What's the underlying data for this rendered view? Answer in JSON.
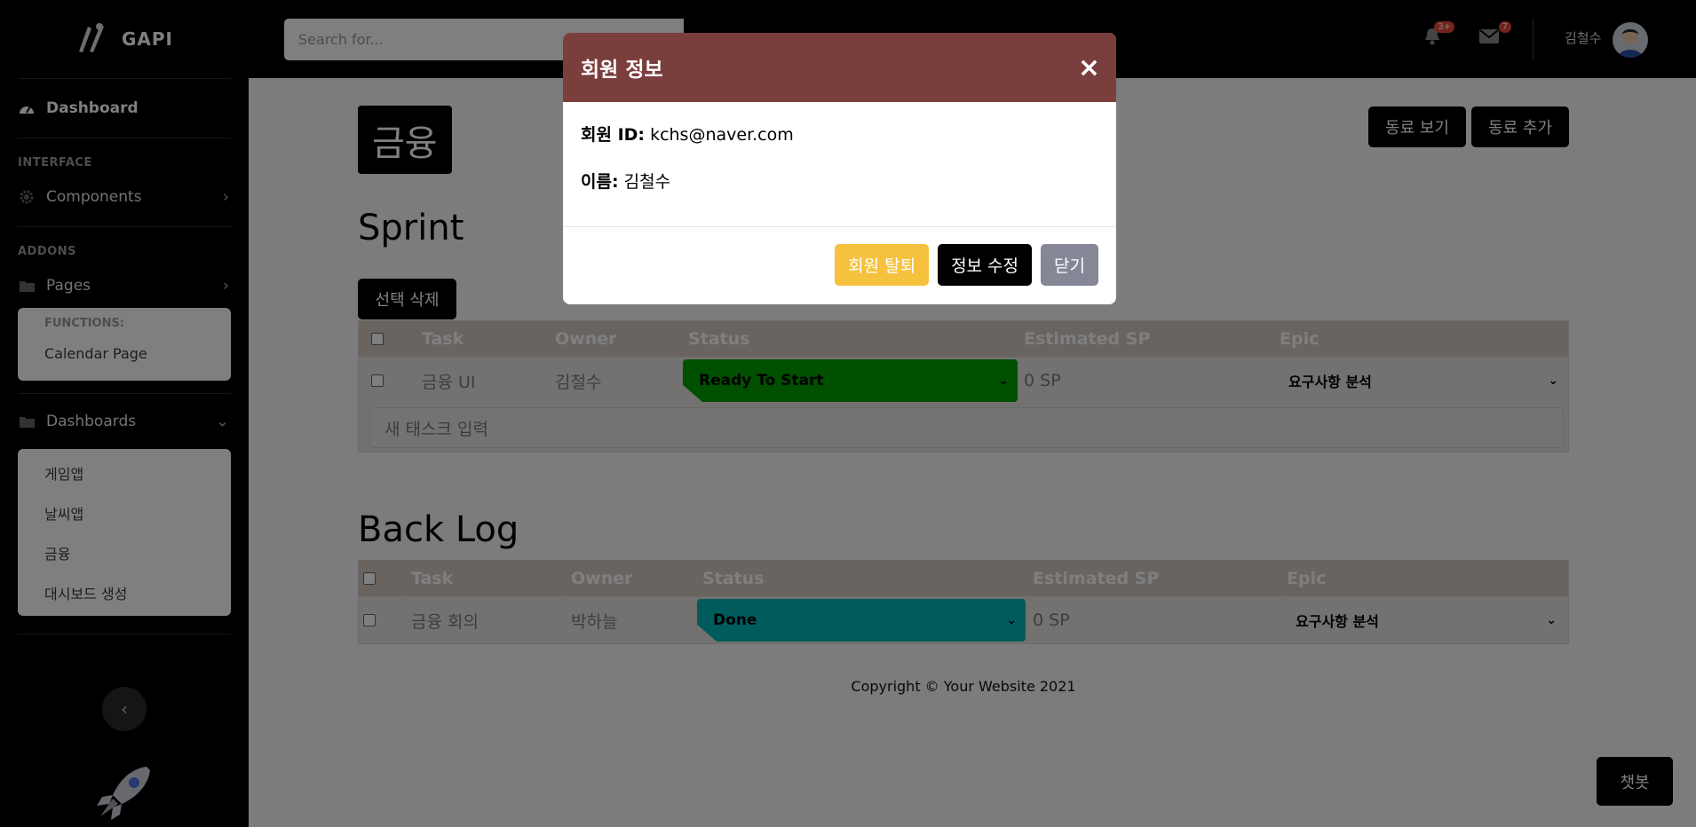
{
  "brand": {
    "name": "GAPI"
  },
  "sidebar": {
    "dashboard_label": "Dashboard",
    "interface_heading": "INTERFACE",
    "components_label": "Components",
    "addons_heading": "ADDONS",
    "pages_label": "Pages",
    "functions_heading": "FUNCTIONS:",
    "calendar_label": "Calendar Page",
    "dashboards_label": "Dashboards",
    "dashboard_items": [
      "게임앱",
      "날씨앱",
      "금융",
      "대시보드 생성"
    ]
  },
  "topbar": {
    "search_placeholder": "Search for...",
    "alerts_badge": "3+",
    "messages_badge": "7",
    "user_name": "김철수"
  },
  "main": {
    "page_title": "금융",
    "view_colleagues": "동료 보기",
    "add_colleague": "동료 추가",
    "sprint_title": "Sprint",
    "delete_selected": "선택 삭제",
    "backlog_title": "Back Log",
    "new_task_placeholder": "새 태스크 입력",
    "columns": [
      "Task",
      "Owner",
      "Status",
      "Estimated SP",
      "Epic"
    ],
    "sprint_rows": [
      {
        "task": "금융 UI",
        "owner": "김철수",
        "status": "Ready To Start",
        "sp": "0 SP",
        "epic": "요구사항 분석"
      }
    ],
    "backlog_rows": [
      {
        "task": "금융 회의",
        "owner": "박하늘",
        "status": "Done",
        "sp": "0 SP",
        "epic": "요구사항 분석"
      }
    ],
    "copyright": "Copyright © Your Website 2021",
    "chatbot": "챗봇"
  },
  "modal": {
    "title": "회원 정보",
    "id_label": "회원 ID:",
    "id_value": "kchs@naver.com",
    "name_label": "이름:",
    "name_value": "김철수",
    "withdraw_button": "회원 탈퇴",
    "edit_button": "정보 수정",
    "close_button": "닫기",
    "close_icon": "×"
  },
  "colors": {
    "status_ready": "#00a000",
    "status_done": "#00b9b9",
    "modal_header": "#7a3e3c",
    "withdraw": "#f6c23e",
    "close": "#858796"
  }
}
